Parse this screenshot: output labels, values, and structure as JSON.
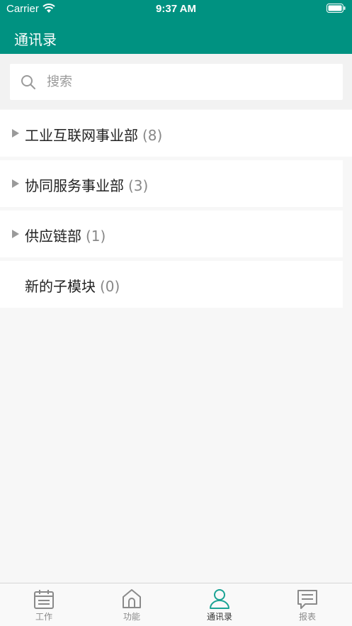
{
  "status_bar": {
    "carrier": "Carrier",
    "time": "9:37 AM"
  },
  "nav": {
    "title": "通讯录"
  },
  "search": {
    "placeholder": "搜索"
  },
  "departments": [
    {
      "name": "工业互联网事业部",
      "count": "(8)",
      "expandable": true
    },
    {
      "name": "协同服务事业部",
      "count": "(3)",
      "expandable": true
    },
    {
      "name": "供应链部",
      "count": "(1)",
      "expandable": true
    },
    {
      "name": "新的子模块",
      "count": "(0)",
      "expandable": false
    }
  ],
  "tabs": [
    {
      "label": "工作",
      "icon": "calendar-icon",
      "active": false
    },
    {
      "label": "功能",
      "icon": "home-icon",
      "active": false
    },
    {
      "label": "通讯录",
      "icon": "person-icon",
      "active": true
    },
    {
      "label": "报表",
      "icon": "message-icon",
      "active": false
    }
  ],
  "colors": {
    "primary": "#009281",
    "active_tab": "#1aa394",
    "inactive_tab": "#8a8a8a"
  }
}
